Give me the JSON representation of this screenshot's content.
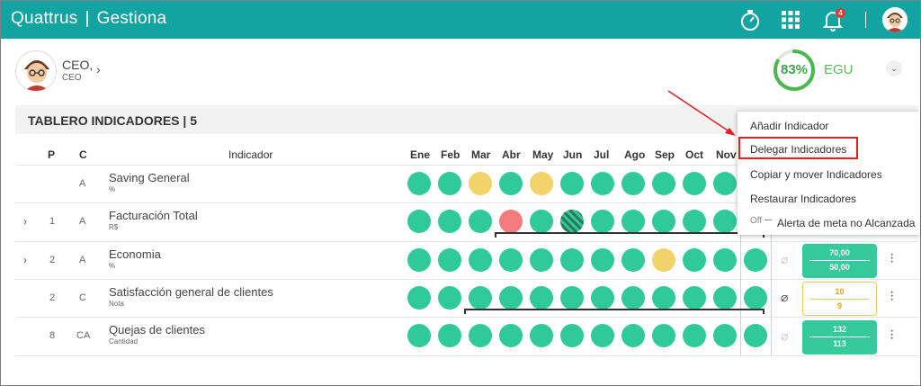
{
  "app": {
    "brand": "Quattrus",
    "module": "Gestiona",
    "notif_count": "4"
  },
  "user": {
    "role": "CEO,",
    "sub": "CEO"
  },
  "score": {
    "value": "83%",
    "label": "EGU",
    "percent": 83
  },
  "panel": {
    "title": "TABLERO INDICADORES | 5"
  },
  "columns": {
    "p": "P",
    "c": "C",
    "indicator": "Indicador",
    "months": [
      "Ene",
      "Feb",
      "Mar",
      "Abr",
      "May",
      "Jun",
      "Jul",
      "Ago",
      "Sep",
      "Oct",
      "Nov"
    ]
  },
  "rows": [
    {
      "p": "",
      "c": "A",
      "name": "Saving General",
      "unit": "%",
      "expandable": false
    },
    {
      "p": "1",
      "c": "A",
      "name": "Facturación Total",
      "unit": "R$",
      "expandable": true
    },
    {
      "p": "2",
      "c": "A",
      "name": "Economia",
      "unit": "%",
      "expandable": true,
      "target": "70,00",
      "actual": "50,00"
    },
    {
      "p": "2",
      "c": "C",
      "name": "Satisfacción general de clientes",
      "unit": "Nota",
      "expandable": false,
      "target": "10",
      "actual": "9"
    },
    {
      "p": "8",
      "c": "CA",
      "name": "Quejas de clientes",
      "unit": "Cantidad",
      "expandable": false,
      "target": "132",
      "actual": "113"
    }
  ],
  "menu": {
    "items": [
      "Añadir Indicador",
      "Delegar Indicadores",
      "Copiar y mover Indicadores",
      "Restaurar Indicadores",
      "Alerta de meta no Alcanzada"
    ],
    "toggle_state": "Off",
    "highlighted": "Delegar Indicadores"
  },
  "colors": {
    "header": "#13a3a0",
    "green": "#2fc99a",
    "yellow": "#f2d36b",
    "red": "#f47c7c",
    "highlight": "#e02020"
  },
  "icons": [
    "stopwatch-icon",
    "apps-grid-icon",
    "bell-icon",
    "avatar",
    "chevron-right-icon",
    "chevron-down-icon",
    "paperclip-icon",
    "kebab-menu-icon"
  ]
}
